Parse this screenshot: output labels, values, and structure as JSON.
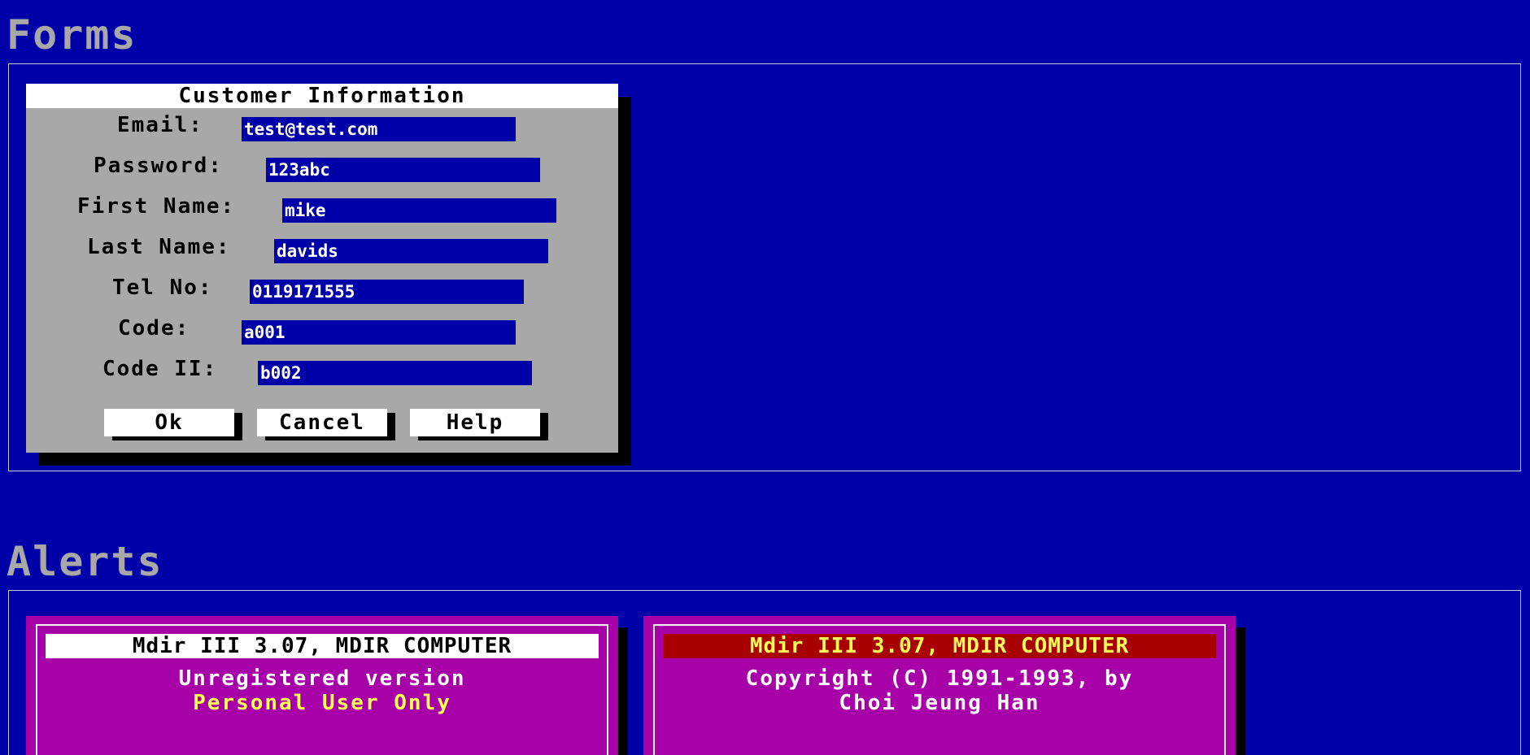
{
  "sections": {
    "forms_title": "Forms",
    "alerts_title": "Alerts"
  },
  "dialog": {
    "title": "Customer Information",
    "fields": [
      {
        "label": "Email:",
        "value": "test@test.com"
      },
      {
        "label": "Password:",
        "value": "123abc"
      },
      {
        "label": "First Name:",
        "value": "mike"
      },
      {
        "label": "Last Name:",
        "value": "davids"
      },
      {
        "label": "Tel No:",
        "value": "0119171555"
      },
      {
        "label": "Code:",
        "value": "a001"
      },
      {
        "label": "Code II:",
        "value": "b002"
      }
    ],
    "buttons": {
      "ok": "Ok",
      "cancel": "Cancel",
      "help": "Help"
    }
  },
  "alerts": [
    {
      "title": "Mdir III 3.07, MDIR COMPUTER",
      "line1": "Unregistered version",
      "line2": "Personal User Only"
    },
    {
      "title": "Mdir III 3.07, MDIR COMPUTER",
      "line1": "Copyright (C) 1991-1993, by",
      "line2": "Choi Jeung Han"
    }
  ],
  "colors": {
    "background": "#0000a8",
    "dialog": "#a8a8a8",
    "alert": "#a800a8",
    "alert_title_red": "#a80000",
    "highlight_yellow": "#ffff54",
    "heading_gray": "#a8a8a8"
  }
}
